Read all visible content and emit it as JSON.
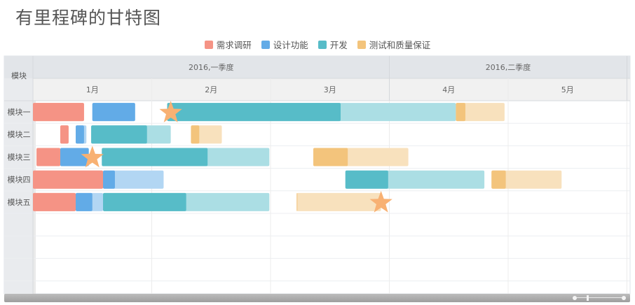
{
  "title": "有里程碑的甘特图",
  "chart_data": {
    "type": "gantt",
    "title": "有里程碑的甘特图",
    "row_header": "模块",
    "quarters": [
      {
        "label": "2016,一季度",
        "start": 0,
        "end": 3
      },
      {
        "label": "2016,二季度",
        "start": 3,
        "end": 5
      }
    ],
    "months": [
      "1月",
      "2月",
      "3月",
      "4月",
      "5月"
    ],
    "rows": [
      "模块一",
      "模块二",
      "模块三",
      "模块四",
      "模块五"
    ],
    "tasks": [
      {
        "row": 0,
        "phase": "需求调研",
        "start": 0.0,
        "end": 0.43,
        "done": 0.43
      },
      {
        "row": 0,
        "phase": "设计功能",
        "start": 0.5,
        "end": 0.86,
        "done": 0.86
      },
      {
        "row": 0,
        "phase": "开发",
        "start": 1.13,
        "end": 3.56,
        "done": 2.59
      },
      {
        "row": 0,
        "phase": "测试和质量保证",
        "start": 3.56,
        "end": 3.97,
        "done": 3.64
      },
      {
        "row": 1,
        "phase": "需求调研",
        "start": 0.23,
        "end": 0.3,
        "done": 0.3
      },
      {
        "row": 1,
        "phase": "设计功能",
        "start": 0.36,
        "end": 0.45,
        "done": 0.43
      },
      {
        "row": 1,
        "phase": "开发",
        "start": 0.49,
        "end": 1.16,
        "done": 0.96
      },
      {
        "row": 1,
        "phase": "测试和质量保证",
        "start": 1.33,
        "end": 1.59,
        "done": 1.4
      },
      {
        "row": 2,
        "phase": "需求调研",
        "start": 0.03,
        "end": 0.23,
        "done": 0.23
      },
      {
        "row": 2,
        "phase": "设计功能",
        "start": 0.23,
        "end": 0.47,
        "done": 0.47
      },
      {
        "row": 2,
        "phase": "开发",
        "start": 0.58,
        "end": 1.99,
        "done": 1.47
      },
      {
        "row": 2,
        "phase": "测试和质量保证",
        "start": 2.36,
        "end": 3.16,
        "done": 2.65
      },
      {
        "row": 3,
        "phase": "需求调研",
        "start": 0.0,
        "end": 0.59,
        "done": 0.59
      },
      {
        "row": 3,
        "phase": "设计功能",
        "start": 0.59,
        "end": 1.1,
        "done": 0.69
      },
      {
        "row": 3,
        "phase": "开发",
        "start": 2.63,
        "end": 3.8,
        "done": 2.99
      },
      {
        "row": 3,
        "phase": "测试和质量保证",
        "start": 3.86,
        "end": 4.45,
        "done": 3.98
      },
      {
        "row": 4,
        "phase": "需求调研",
        "start": 0.0,
        "end": 0.36,
        "done": 0.36
      },
      {
        "row": 4,
        "phase": "设计功能",
        "start": 0.36,
        "end": 0.59,
        "done": 0.5
      },
      {
        "row": 4,
        "phase": "开发",
        "start": 0.59,
        "end": 1.99,
        "done": 1.29
      },
      {
        "row": 4,
        "phase": "测试和质量保证",
        "start": 2.22,
        "end": 2.93,
        "done": 2.22
      }
    ],
    "milestones": [
      {
        "row": 0,
        "at": 1.16
      },
      {
        "row": 2,
        "at": 0.5
      },
      {
        "row": 4,
        "at": 2.93
      }
    ],
    "legend_position": "top-center",
    "grid": true
  },
  "legend": [
    {
      "name": "需求调研",
      "color": "#f59385",
      "light": "#f8beb5"
    },
    {
      "name": "设计功能",
      "color": "#62abe7",
      "light": "#b2d6f3"
    },
    {
      "name": "开发",
      "color": "#57bcc8",
      "light": "#abdee4"
    },
    {
      "name": "测试和质量保证",
      "color": "#f3c47c",
      "light": "#f8e1bd"
    }
  ],
  "milestone_color": "#f8b173"
}
